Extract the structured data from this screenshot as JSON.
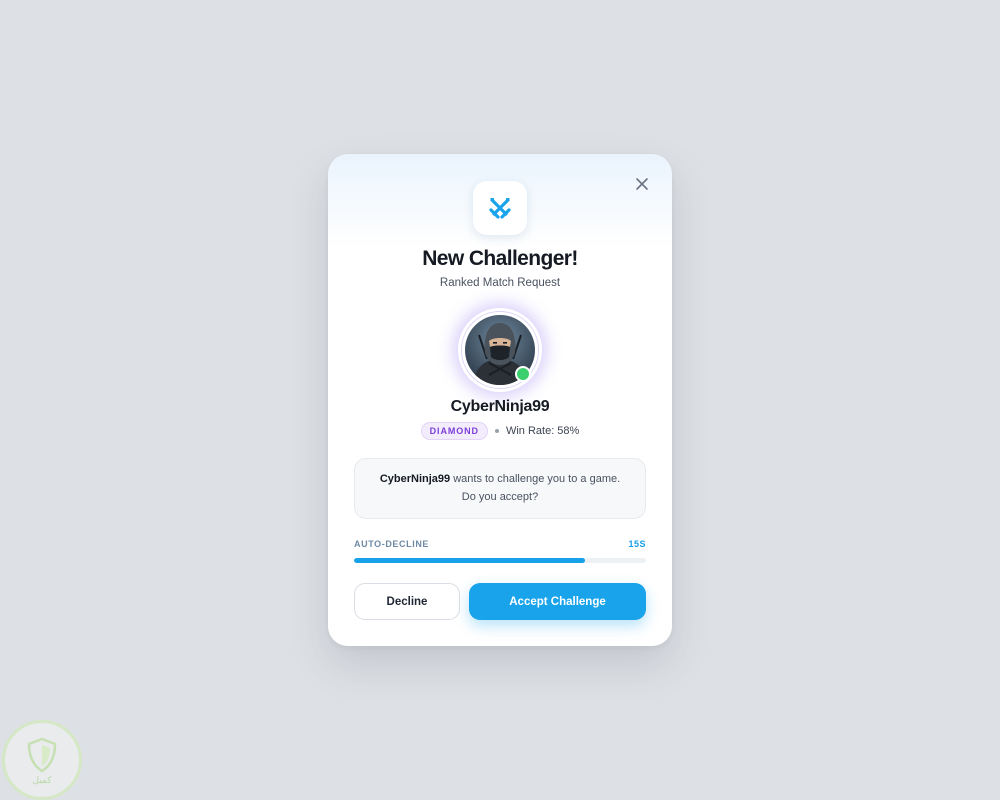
{
  "dialog": {
    "title": "New Challenger!",
    "subtitle": "Ranked Match Request",
    "close_icon": "close-icon",
    "header_icon": "crossed-swords-icon",
    "accent_color": "#18a3ea"
  },
  "challenger": {
    "username": "CyberNinja99",
    "rank": "DIAMOND",
    "win_rate": "Win Rate: 58%",
    "online": true,
    "online_color": "#3ccf6d",
    "avatar": "ninja-avatar"
  },
  "message": {
    "name": "CyberNinja99",
    "text": " wants to challenge you to a game. Do you accept?"
  },
  "timer": {
    "label": "AUTO-DECLINE",
    "value": "15S",
    "progress_percent": 79
  },
  "actions": {
    "decline_label": "Decline",
    "accept_label": "Accept Challenge"
  },
  "watermark": {
    "text": "كمبل"
  }
}
